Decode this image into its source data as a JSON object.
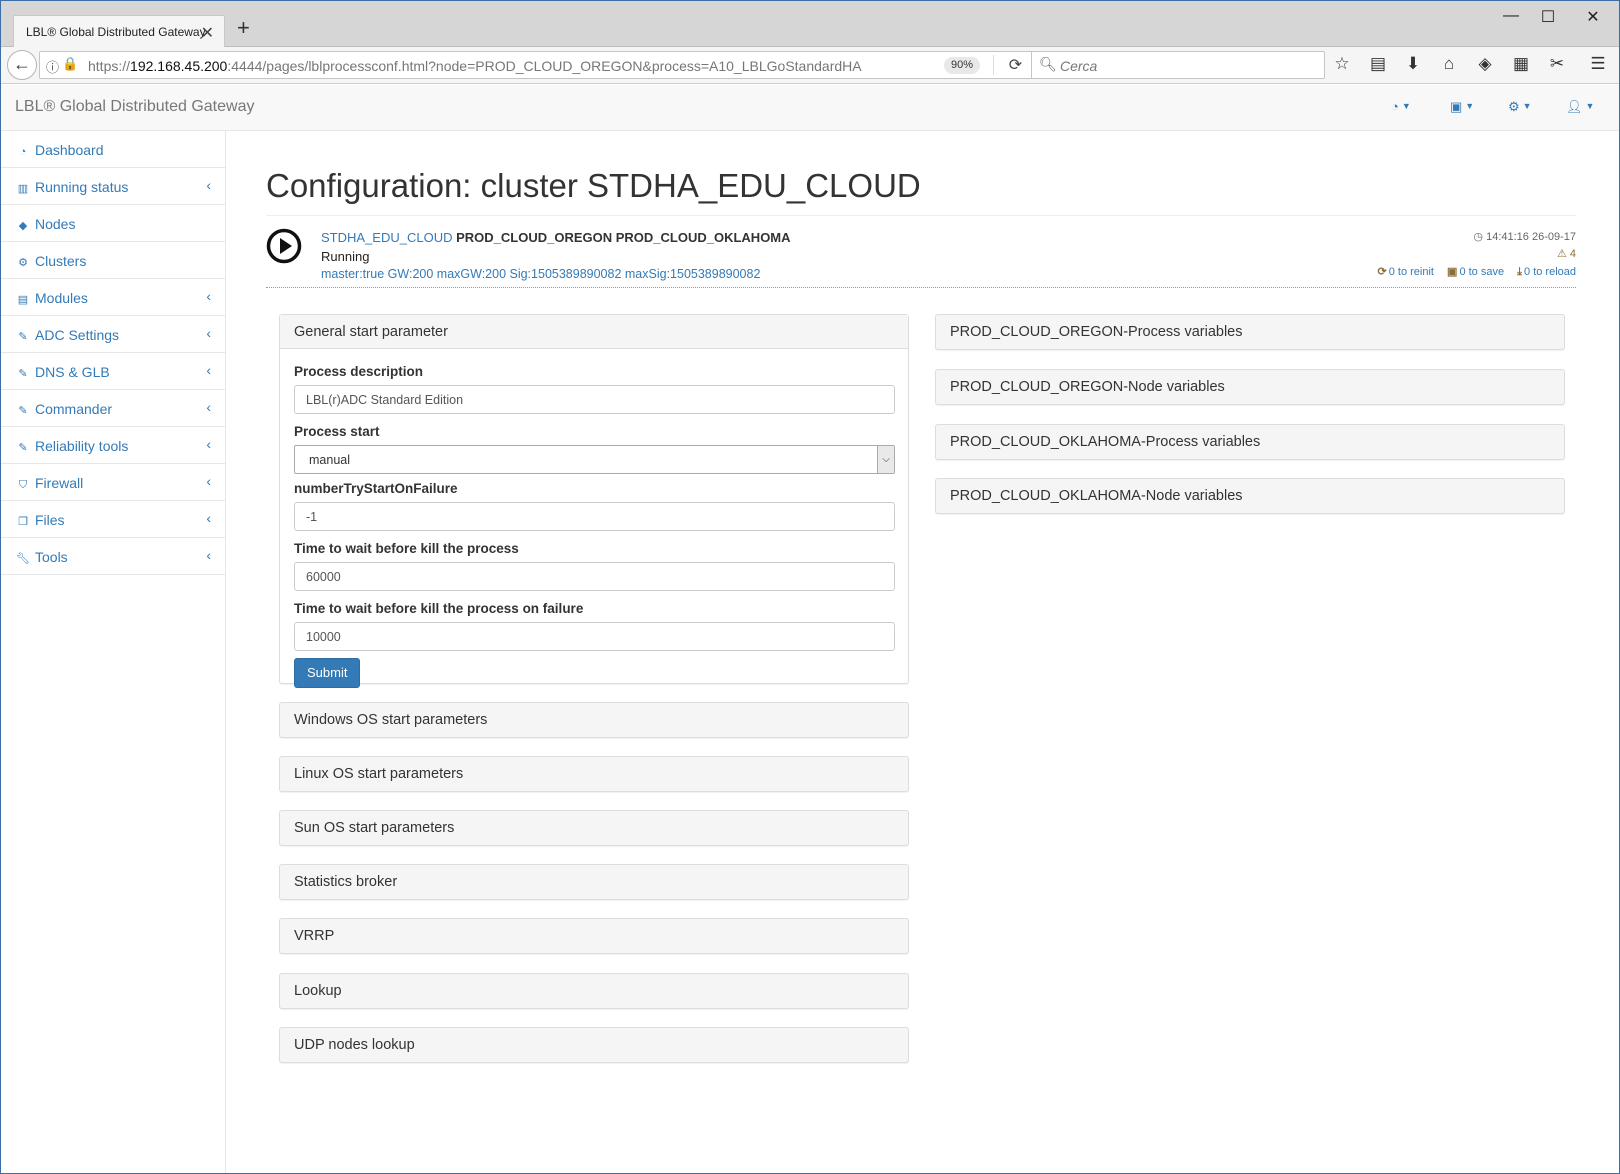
{
  "browser": {
    "tab_title": "LBL® Global Distributed Gateway",
    "url_prefix": "https://",
    "url_host": "192.168.45.200",
    "url_rest": ":4444/pages/lblprocessconf.html?node=PROD_CLOUD_OREGON&process=A10_LBLGoStandardHA",
    "zoom": "90%",
    "search_placeholder": "Cerca"
  },
  "app": {
    "brand": "LBL® Global Distributed Gateway"
  },
  "sidebar": {
    "items": [
      {
        "label": "Dashboard",
        "icon": "dashboard-icon"
      },
      {
        "label": "Running status",
        "icon": "bar-chart-icon"
      },
      {
        "label": "Nodes",
        "icon": "cube-icon"
      },
      {
        "label": "Clusters",
        "icon": "cogs-icon"
      },
      {
        "label": "Modules",
        "icon": "list-icon"
      },
      {
        "label": "ADC Settings",
        "icon": "edit-icon"
      },
      {
        "label": "DNS & GLB",
        "icon": "edit-icon"
      },
      {
        "label": "Commander",
        "icon": "edit-icon"
      },
      {
        "label": "Reliability tools",
        "icon": "edit-icon"
      },
      {
        "label": "Firewall",
        "icon": "shield-icon"
      },
      {
        "label": "Files",
        "icon": "files-icon"
      },
      {
        "label": "Tools",
        "icon": "wrench-icon"
      }
    ]
  },
  "page": {
    "title": "Configuration: cluster STDHA_EDU_CLOUD",
    "cluster_name": "STDHA_EDU_CLOUD",
    "nodes": "PROD_CLOUD_OREGON PROD_CLOUD_OKLAHOMA",
    "state": "Running",
    "signature": "master:true GW:200 maxGW:200 Sig:1505389890082 maxSig:1505389890082",
    "timestamp": "14:41:16 26-09-17",
    "warnings": "4",
    "reinit": "0 to reinit",
    "save": "0 to save",
    "reload": "0 to reload"
  },
  "general": {
    "title": "General start parameter",
    "desc_label": "Process description",
    "desc_value": "LBL(r)ADC Standard Edition",
    "start_label": "Process start",
    "start_value": "manual",
    "try_label": "numberTryStartOnFailure",
    "try_value": "-1",
    "kill_label": "Time to wait before kill the process",
    "kill_value": "60000",
    "killfail_label": "Time to wait before kill the process on failure",
    "killfail_value": "10000",
    "submit": "Submit"
  },
  "left_panels": [
    "Windows OS start parameters",
    "Linux OS start parameters",
    "Sun OS start parameters",
    "Statistics broker",
    "VRRP",
    "Lookup",
    "UDP nodes lookup"
  ],
  "right_panels": [
    "PROD_CLOUD_OREGON-Process variables",
    "PROD_CLOUD_OREGON-Node variables",
    "PROD_CLOUD_OKLAHOMA-Process variables",
    "PROD_CLOUD_OKLAHOMA-Node variables"
  ],
  "colors": {
    "link": "#337ab7",
    "warning": "#8a6d3b",
    "primary_button": "#337ab7"
  }
}
